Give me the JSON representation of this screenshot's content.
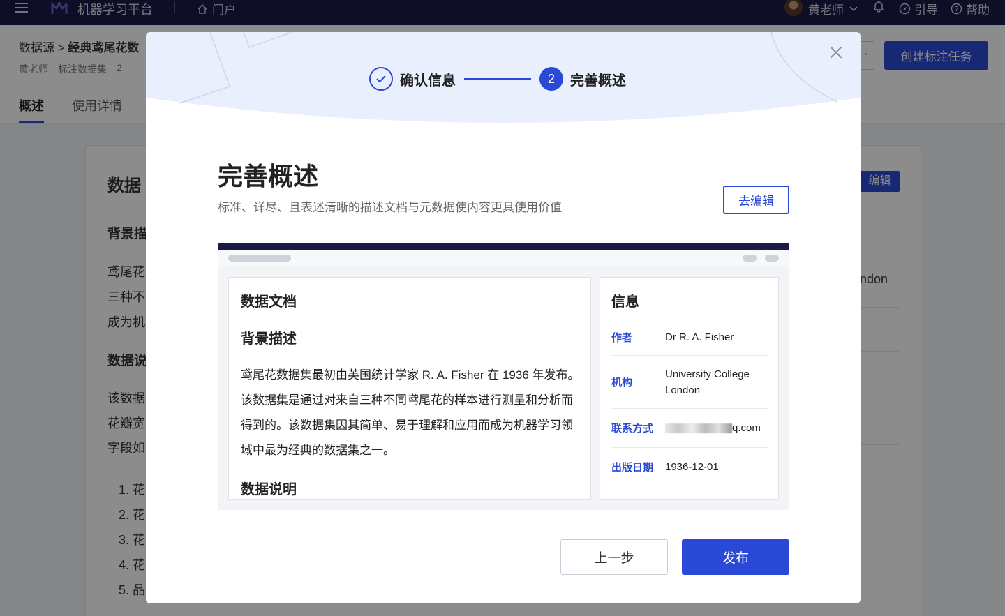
{
  "topbar": {
    "app_title": "机器学习平台",
    "portal": "门户",
    "user_name": "黄老师",
    "guide": "引导",
    "help": "帮助"
  },
  "page": {
    "breadcrumb_root": "数据源",
    "breadcrumb_sep": ">",
    "breadcrumb_current": "经典鸢尾花数",
    "meta": [
      "黄老师",
      "标注数据集",
      "2"
    ],
    "create_task": "创建标注任务",
    "more": "·",
    "tabs": [
      "概述",
      "使用详情"
    ],
    "card_title": "数据",
    "section_bg": "背景描",
    "bg_lines": [
      "鸢尾花",
      "三种不",
      "成为机"
    ],
    "section_desc": "数据说",
    "desc_lines": [
      "该数据",
      "花瓣宽",
      "字段如"
    ],
    "list": [
      "1. 花",
      "2. 花",
      "3. 花",
      "4. 花",
      "5. 品"
    ],
    "edit_label": "编辑",
    "right_fragment": "ndon"
  },
  "modal": {
    "step1_label": "确认信息",
    "step2_number": "2",
    "step2_label": "完善概述",
    "title": "完善概述",
    "subtitle": "标准、详尽、且表述清晰的描述文档与元数据使内容更具使用价值",
    "edit_button": "去编辑",
    "doc": {
      "heading": "数据文档",
      "bg_heading": "背景描述",
      "bg_body": "鸢尾花数据集最初由英国统计学家 R. A. Fisher 在 1936 年发布。该数据集是通过对来自三种不同鸢尾花的样本进行测量和分析而得到的。该数据集因其简单、易于理解和应用而成为机器学习领域中最为经典的数据集之一。",
      "desc_heading": "数据说明"
    },
    "info": {
      "heading": "信息",
      "rows": [
        {
          "key": "作者",
          "value": "Dr R. A. Fisher"
        },
        {
          "key": "机构",
          "value": "University College London"
        },
        {
          "key": "联系方式",
          "value": "q.com"
        },
        {
          "key": "出版日期",
          "value": "1936-12-01"
        }
      ]
    },
    "prev_button": "上一步",
    "publish_button": "发布"
  },
  "colors": {
    "accent": "#2a49d6",
    "topbar": "#1b1c45"
  }
}
